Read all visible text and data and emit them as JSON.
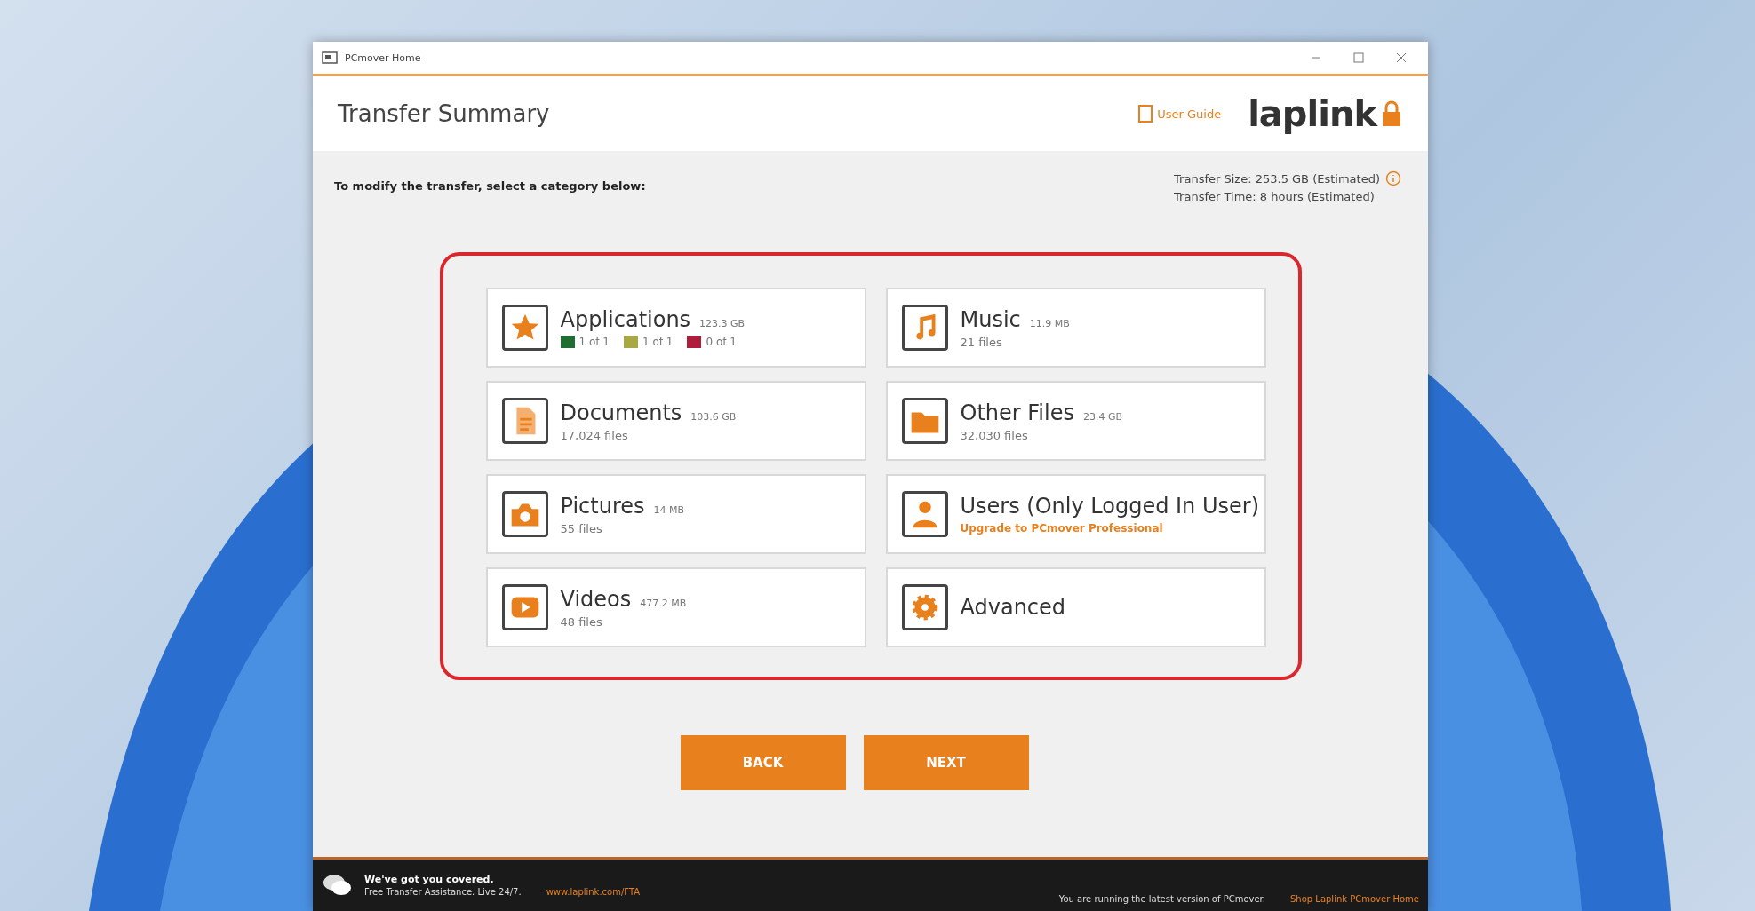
{
  "window": {
    "title": "PCmover Home"
  },
  "header": {
    "title": "Transfer Summary",
    "user_guide": "User Guide",
    "logo": "laplink"
  },
  "instruction": "To modify the transfer, select a category below:",
  "transfer_info": [
    "Transfer Size: 253.5 GB (Estimated)",
    "Transfer Time: 8 hours (Estimated)"
  ],
  "categories": [
    {
      "name": "Applications",
      "size": "123.3 GB",
      "legend": [
        {
          "color": "#1e6e32",
          "text": "1 of 1"
        },
        {
          "color": "#a8a845",
          "text": "1 of 1"
        },
        {
          "color": "#b01c3c",
          "text": "0 of 1"
        }
      ]
    },
    {
      "name": "Music",
      "size": "11.9 MB",
      "detail": "21 files"
    },
    {
      "name": "Documents",
      "size": "103.6 GB",
      "detail": "17,024 files"
    },
    {
      "name": "Other Files",
      "size": "23.4 GB",
      "detail": "32,030 files"
    },
    {
      "name": "Pictures",
      "size": "14 MB",
      "detail": "55 files"
    },
    {
      "name": "Users (Only Logged In User)",
      "link": "Upgrade to PCmover Professional"
    },
    {
      "name": "Videos",
      "size": "477.2 MB",
      "detail": "48 files"
    },
    {
      "name": "Advanced"
    }
  ],
  "buttons": [
    "BACK",
    "NEXT"
  ],
  "footer": {
    "headline": "We've got you covered.",
    "text": "Free Transfer Assistance. Live 24/7.",
    "link": "www.laplink.com/FTA",
    "status": "You are running the latest version of PCmover.",
    "shop_link": "Shop Laplink PCmover Home"
  }
}
